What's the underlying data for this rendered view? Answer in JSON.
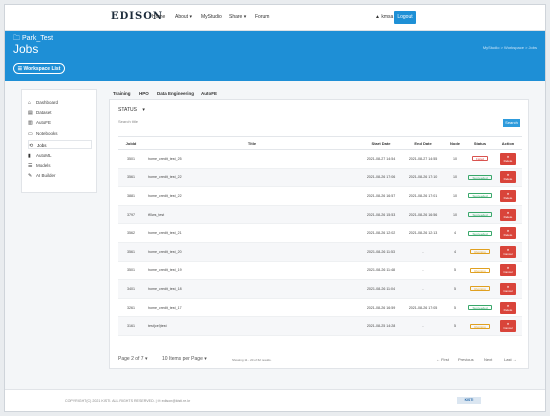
{
  "nav": {
    "logo": "EDISON",
    "items": [
      "Home",
      "About ▾",
      "MyStudio",
      "Share ▾",
      "Forum"
    ],
    "user": "▲ kmsa",
    "logout": "Logout"
  },
  "banner": {
    "workspace": "🗀 Park_Test",
    "title": "Jobs",
    "workspace_list": "☰ Workspace List",
    "breadcrumb": "MyStudio > Workspace > Jobs"
  },
  "sidebar": {
    "items": [
      {
        "icon": "⌂",
        "label": "Dashboard"
      },
      {
        "icon": "▤",
        "label": "Dataset"
      },
      {
        "icon": "▥",
        "label": "AutoFE"
      },
      {
        "icon": "▭",
        "label": "Notebooks"
      },
      {
        "icon": "⟲",
        "label": "Jobs"
      },
      {
        "icon": "▮",
        "label": "AutoML"
      },
      {
        "icon": "☰",
        "label": "Models"
      },
      {
        "icon": "✎",
        "label": "AI Builder"
      }
    ]
  },
  "tabs": [
    "Training",
    "HPO",
    "Data Engineering",
    "AutoFE"
  ],
  "filter": {
    "status_label": "STATUS",
    "status_caret": "▾",
    "search_placeholder": "Search title",
    "search_button": "Search"
  },
  "table": {
    "headers": [
      "JobId",
      "Title",
      "Start Date",
      "End Date",
      "Node",
      "Status",
      "Action"
    ],
    "rows": [
      {
        "id": "3501",
        "title": "home_credit_test_25",
        "start": "2021-08-27 14:54",
        "end": "2021-08-27 14:55",
        "node": "10",
        "status": "Failed",
        "action": "Delete"
      },
      {
        "id": "3561",
        "title": "home_credit_test_22",
        "start": "2021-08-26 17:06",
        "end": "2021-08-26 17:10",
        "node": "10",
        "status": "Succeeded",
        "action": "Delete"
      },
      {
        "id": "3881",
        "title": "home_credit_test_22",
        "start": "2021-08-26 16:57",
        "end": "2021-08-26 17:01",
        "node": "10",
        "status": "Succeeded",
        "action": "Delete"
      },
      {
        "id": "3797",
        "title": "tf0ws_test",
        "start": "2021-08-26 15:53",
        "end": "2021-08-26 16:56",
        "node": "10",
        "status": "Succeeded",
        "action": "Delete"
      },
      {
        "id": "3562",
        "title": "home_credit_test_21",
        "start": "2021-08-26 12:02",
        "end": "2021-08-26 12:13",
        "node": "4",
        "status": "Succeeded",
        "action": "Delete"
      },
      {
        "id": "3561",
        "title": "home_credit_test_20",
        "start": "2021-08-26 11:53",
        "end": "-",
        "node": "4",
        "status": "Running",
        "action": "Cancel"
      },
      {
        "id": "3501",
        "title": "home_credit_test_19",
        "start": "2021-08-26 11:48",
        "end": "-",
        "node": "5",
        "status": "Running",
        "action": "Cancel"
      },
      {
        "id": "3401",
        "title": "home_credit_test_18",
        "start": "2021-08-26 11:04",
        "end": "-",
        "node": "5",
        "status": "Running",
        "action": "Cancel"
      },
      {
        "id": "3261",
        "title": "home_credit_test_17",
        "start": "2021-08-26 16:59",
        "end": "2021-08-26 17:05",
        "node": "5",
        "status": "Succeeded",
        "action": "Delete"
      },
      {
        "id": "3161",
        "title": "test(cel)test",
        "start": "2021-08-25 14:28",
        "end": "-",
        "node": "5",
        "status": "Running",
        "action": "Cancel"
      }
    ]
  },
  "pager": {
    "page": "Page 2 of 7 ▾",
    "per_page": "10 Items per Page ▾",
    "showing": "Showing 11 - 20 of 62 results.",
    "first": "← First",
    "previous": "Previous",
    "next": "Next",
    "last": "Last →"
  },
  "footer": {
    "copyright": "COPYRIGHT(C) 2021 KISTI. ALL RIGHTS RESERVED.  |  ✉ edison@kisti.re.kr",
    "logo": "KISTI"
  },
  "colors": {
    "brand_blue": "#1e8fd6",
    "danger": "#d9443a",
    "success": "#3aa86b",
    "warning": "#e0a020"
  }
}
